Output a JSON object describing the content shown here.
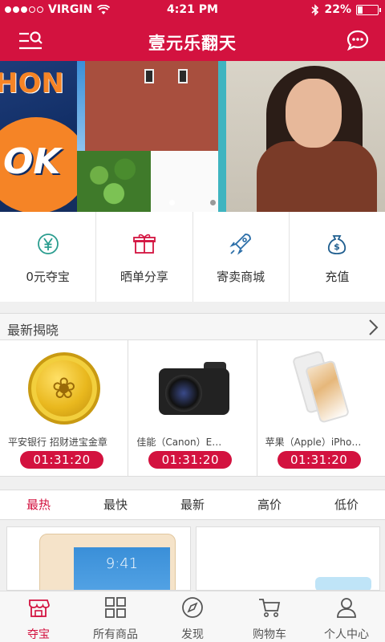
{
  "status": {
    "carrier": "VIRGIN",
    "time": "4:21 PM",
    "battery": "22%",
    "battery_level": 0.22
  },
  "header": {
    "title": "壹元乐翻天"
  },
  "banner": {
    "slides": 3,
    "active_index": 1
  },
  "quick_links": [
    {
      "label": "0元夺宝",
      "icon": "yen-icon"
    },
    {
      "label": "晒单分享",
      "icon": "gift-icon"
    },
    {
      "label": "寄卖商城",
      "icon": "rocket-icon"
    },
    {
      "label": "充值",
      "icon": "money-bag-icon"
    }
  ],
  "latest": {
    "title": "最新揭晓",
    "products": [
      {
        "name": "平安银行 招财进宝金章",
        "timer": "01:31:20"
      },
      {
        "name": "佳能（Canon）E…",
        "timer": "01:31:20"
      },
      {
        "name": "苹果（Apple）iPho…",
        "timer": "01:31:20"
      }
    ]
  },
  "sort_tabs": [
    "最热",
    "最快",
    "最新",
    "高价",
    "低价"
  ],
  "sort_active": "最热",
  "grid": {
    "ipad_time": "9:41"
  },
  "tabbar": [
    {
      "label": "夺宝",
      "icon": "shop-icon",
      "active": true
    },
    {
      "label": "所有商品",
      "icon": "grid-icon",
      "active": false
    },
    {
      "label": "发现",
      "icon": "compass-icon",
      "active": false
    },
    {
      "label": "购物车",
      "icon": "cart-icon",
      "active": false
    },
    {
      "label": "个人中心",
      "icon": "user-icon",
      "active": false
    }
  ],
  "colors": {
    "brand": "#d3123f",
    "teal": "#2a9d8f"
  }
}
